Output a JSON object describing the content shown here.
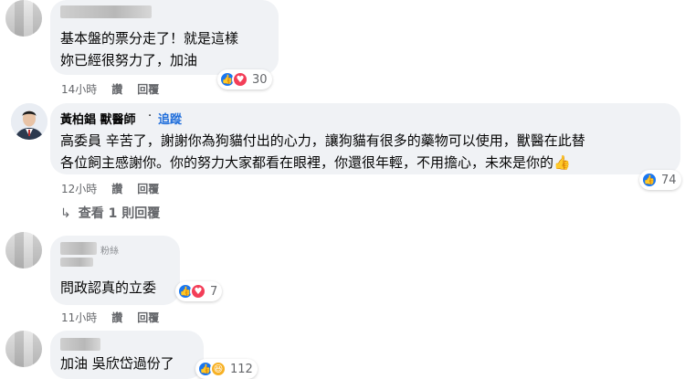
{
  "comments": [
    {
      "lines": [
        "基本盤的票分走了！就是這樣",
        "妳已經很努力了，加油"
      ],
      "time": "14小時",
      "like": "讚",
      "reply": "回覆",
      "reaction_count": "30",
      "reactions": [
        "like-icon",
        "love-icon"
      ]
    },
    {
      "author": "黃柏錩 獸醫師",
      "dot": "·",
      "follow": "追蹤",
      "lines": [
        "高委員 辛苦了，謝謝你為狗貓付出的心力，讓狗貓有很多的藥物可以使用，獸醫在此替",
        "各位飼主感謝你。你的努力大家都看在眼裡，你還很年輕，不用擔心，未來是你的"
      ],
      "emoji": "👍",
      "time": "12小時",
      "like": "讚",
      "reply": "回覆",
      "reaction_count": "74",
      "reactions": [
        "like-icon"
      ],
      "view_replies": "查看 1 則回覆"
    },
    {
      "badge": "粉絲",
      "lines": [
        "問政認真的立委"
      ],
      "time": "11小時",
      "like": "讚",
      "reply": "回覆",
      "reaction_count": "7",
      "reactions": [
        "like-icon",
        "love-icon"
      ]
    },
    {
      "lines": [
        "加油 吳欣岱過份了"
      ],
      "reaction_count": "112",
      "reactions": [
        "like-icon",
        "haha-icon"
      ]
    }
  ],
  "colors": {
    "bubble": "#f0f2f5",
    "link": "#216fdb",
    "meta": "#65676b",
    "like": "#1877f2",
    "love": "#f33e58",
    "haha": "#f7b125"
  }
}
